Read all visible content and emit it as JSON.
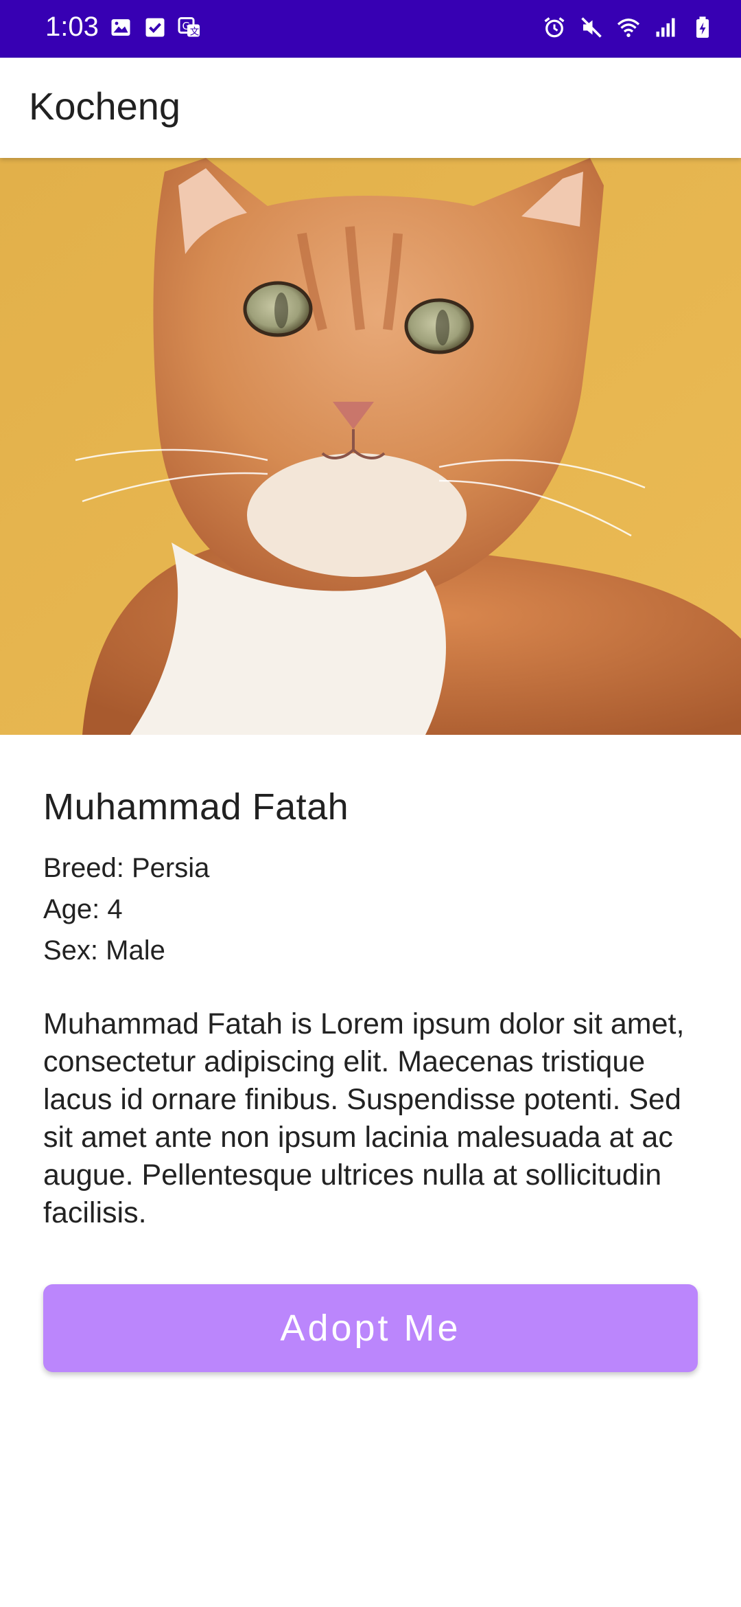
{
  "status_bar": {
    "time": "1:03",
    "background": "#3700b3",
    "left_icons": [
      "image-icon",
      "checkbox-icon",
      "translate-icon"
    ],
    "right_icons": [
      "alarm-icon",
      "mute-icon",
      "wifi-icon",
      "signal-icon",
      "battery-icon"
    ]
  },
  "app_bar": {
    "title": "Kocheng"
  },
  "cat": {
    "name": "Muhammad Fatah",
    "breed": "Breed: Persia",
    "age": "Age: 4",
    "sex": "Sex: Male",
    "description": "Muhammad Fatah is Lorem ipsum dolor sit amet, consectetur adipiscing elit. Maecenas tristique lacus id ornare finibus. Suspendisse potenti. Sed sit amet ante non ipsum lacinia malesuada at ac augue. Pellentesque ultrices nulla at sollicitudin facilisis."
  },
  "actions": {
    "adopt_label": "Adopt Me",
    "adopt_color": "#bb86fc"
  }
}
